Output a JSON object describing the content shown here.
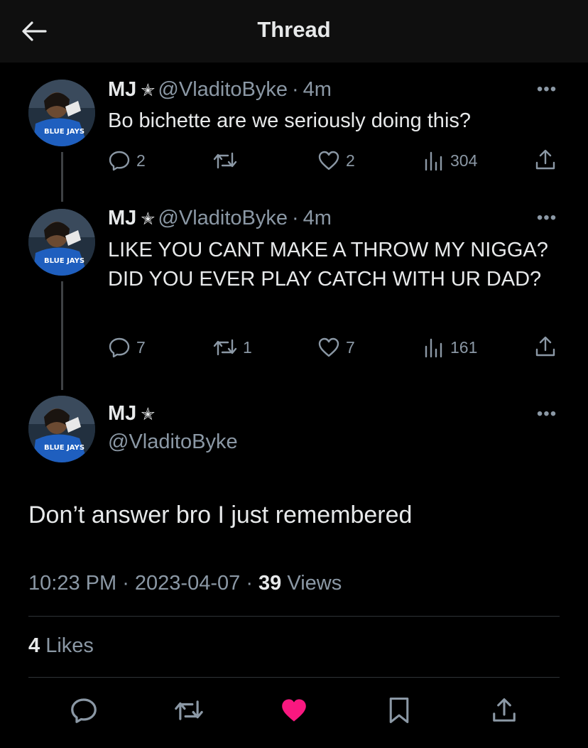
{
  "header": {
    "title": "Thread",
    "back_icon": "arrow-left-icon"
  },
  "tweets": [
    {
      "name": "MJ",
      "badge": "✭",
      "handle": "@VladitoByke",
      "sep": "·",
      "age": "4m",
      "text": "Bo bichette are we seriously doing this?",
      "replies": "2",
      "retweets": "",
      "likes": "2",
      "views": "304"
    },
    {
      "name": "MJ",
      "badge": "✭",
      "handle": "@VladitoByke",
      "sep": "·",
      "age": "4m",
      "text": "LIKE YOU CANT MAKE A THROW MY NIGGA? DID YOU EVER PLAY CATCH WITH UR DAD?",
      "replies": "7",
      "retweets": "1",
      "likes": "7",
      "views": "161"
    }
  ],
  "main_tweet": {
    "name": "MJ",
    "badge": "✭",
    "handle": "@VladitoByke",
    "text": "Don’t answer bro I just remembered",
    "time": "10:23 PM",
    "sep1": " · ",
    "date": "2023-04-07",
    "sep2": " · ",
    "views_count": "39",
    "views_label": " Views",
    "likes_count": "4",
    "likes_label": " Likes"
  },
  "colors": {
    "background": "#000000",
    "text": "#e7e9ea",
    "muted": "#8b98a5",
    "like_active": "#f91880"
  },
  "action_bar": [
    "reply-icon",
    "retweet-icon",
    "like-icon-filled",
    "bookmark-icon",
    "share-icon"
  ]
}
